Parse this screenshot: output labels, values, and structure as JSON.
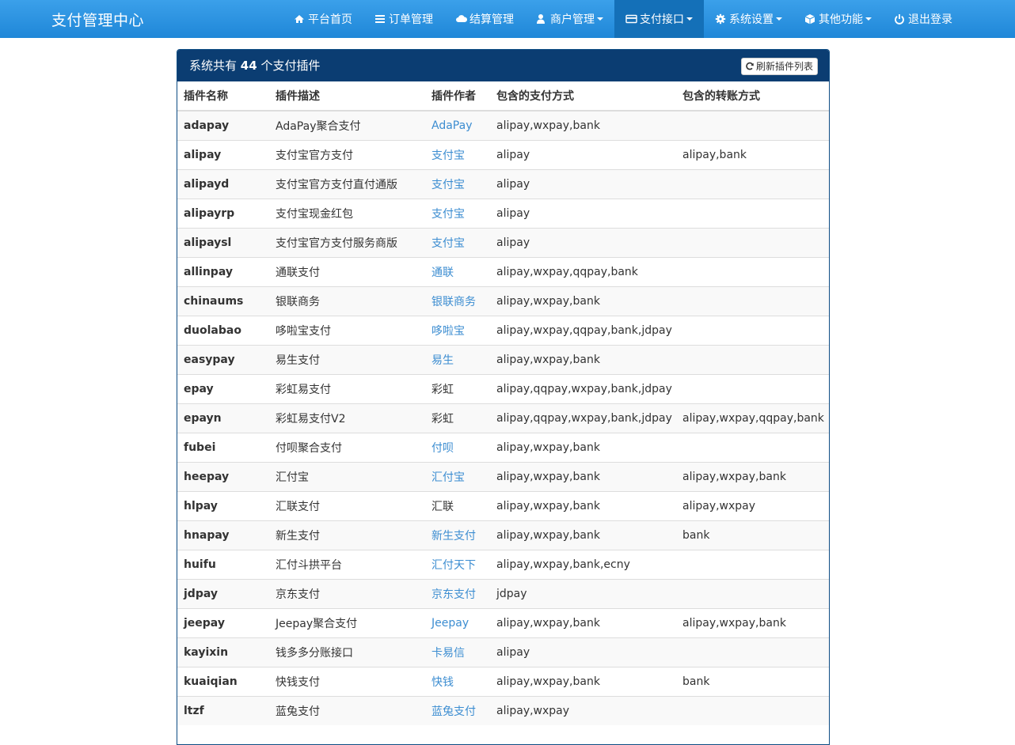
{
  "nav": {
    "brand": "支付管理中心",
    "items": [
      {
        "label": "平台首页",
        "icon": "home-icon",
        "caret": false,
        "active": false
      },
      {
        "label": "订单管理",
        "icon": "list-icon",
        "caret": false,
        "active": false
      },
      {
        "label": "结算管理",
        "icon": "cloud-icon",
        "caret": false,
        "active": false
      },
      {
        "label": "商户管理",
        "icon": "user-icon",
        "caret": true,
        "active": false
      },
      {
        "label": "支付接口",
        "icon": "credit-card-icon",
        "caret": true,
        "active": true
      },
      {
        "label": "系统设置",
        "icon": "gear-icon",
        "caret": true,
        "active": false
      },
      {
        "label": "其他功能",
        "icon": "cube-icon",
        "caret": true,
        "active": false
      },
      {
        "label": "退出登录",
        "icon": "power-icon",
        "caret": false,
        "active": false
      }
    ]
  },
  "panel": {
    "title_prefix": "系统共有",
    "count": "44",
    "title_suffix": "个支付插件",
    "refresh_label": "刷新插件列表"
  },
  "table": {
    "headers": [
      "插件名称",
      "插件描述",
      "插件作者",
      "包含的支付方式",
      "包含的转账方式"
    ],
    "rows": [
      {
        "name": "adapay",
        "desc": "AdaPay聚合支付",
        "author": "AdaPay",
        "author_link": true,
        "pay": "alipay,wxpay,bank",
        "transfer": ""
      },
      {
        "name": "alipay",
        "desc": "支付宝官方支付",
        "author": "支付宝",
        "author_link": true,
        "pay": "alipay",
        "transfer": "alipay,bank"
      },
      {
        "name": "alipayd",
        "desc": "支付宝官方支付直付通版",
        "author": "支付宝",
        "author_link": true,
        "pay": "alipay",
        "transfer": ""
      },
      {
        "name": "alipayrp",
        "desc": "支付宝现金红包",
        "author": "支付宝",
        "author_link": true,
        "pay": "alipay",
        "transfer": ""
      },
      {
        "name": "alipaysl",
        "desc": "支付宝官方支付服务商版",
        "author": "支付宝",
        "author_link": true,
        "pay": "alipay",
        "transfer": ""
      },
      {
        "name": "allinpay",
        "desc": "通联支付",
        "author": "通联",
        "author_link": true,
        "pay": "alipay,wxpay,qqpay,bank",
        "transfer": ""
      },
      {
        "name": "chinaums",
        "desc": "银联商务",
        "author": "银联商务",
        "author_link": true,
        "pay": "alipay,wxpay,bank",
        "transfer": ""
      },
      {
        "name": "duolabao",
        "desc": "哆啦宝支付",
        "author": "哆啦宝",
        "author_link": true,
        "pay": "alipay,wxpay,qqpay,bank,jdpay",
        "transfer": ""
      },
      {
        "name": "easypay",
        "desc": "易生支付",
        "author": "易生",
        "author_link": true,
        "pay": "alipay,wxpay,bank",
        "transfer": ""
      },
      {
        "name": "epay",
        "desc": "彩虹易支付",
        "author": "彩虹",
        "author_link": false,
        "pay": "alipay,qqpay,wxpay,bank,jdpay",
        "transfer": ""
      },
      {
        "name": "epayn",
        "desc": "彩虹易支付V2",
        "author": "彩虹",
        "author_link": false,
        "pay": "alipay,qqpay,wxpay,bank,jdpay",
        "transfer": "alipay,wxpay,qqpay,bank"
      },
      {
        "name": "fubei",
        "desc": "付呗聚合支付",
        "author": "付呗",
        "author_link": true,
        "pay": "alipay,wxpay,bank",
        "transfer": ""
      },
      {
        "name": "heepay",
        "desc": "汇付宝",
        "author": "汇付宝",
        "author_link": true,
        "pay": "alipay,wxpay,bank",
        "transfer": "alipay,wxpay,bank"
      },
      {
        "name": "hlpay",
        "desc": "汇联支付",
        "author": "汇联",
        "author_link": false,
        "pay": "alipay,wxpay,bank",
        "transfer": "alipay,wxpay"
      },
      {
        "name": "hnapay",
        "desc": "新生支付",
        "author": "新生支付",
        "author_link": true,
        "pay": "alipay,wxpay,bank",
        "transfer": "bank"
      },
      {
        "name": "huifu",
        "desc": "汇付斗拱平台",
        "author": "汇付天下",
        "author_link": true,
        "pay": "alipay,wxpay,bank,ecny",
        "transfer": ""
      },
      {
        "name": "jdpay",
        "desc": "京东支付",
        "author": "京东支付",
        "author_link": true,
        "pay": "jdpay",
        "transfer": ""
      },
      {
        "name": "jeepay",
        "desc": "Jeepay聚合支付",
        "author": "Jeepay",
        "author_link": true,
        "pay": "alipay,wxpay,bank",
        "transfer": "alipay,wxpay,bank"
      },
      {
        "name": "kayixin",
        "desc": "钱多多分账接口",
        "author": "卡易信",
        "author_link": true,
        "pay": "alipay",
        "transfer": ""
      },
      {
        "name": "kuaiqian",
        "desc": "快钱支付",
        "author": "快钱",
        "author_link": true,
        "pay": "alipay,wxpay,bank",
        "transfer": "bank"
      },
      {
        "name": "ltzf",
        "desc": "蓝兔支付",
        "author": "蓝兔支付",
        "author_link": true,
        "pay": "alipay,wxpay",
        "transfer": ""
      }
    ]
  },
  "colors": {
    "navbar": "#2a94e2",
    "nav_active": "#1470b8",
    "panel_heading": "#0b3d72",
    "link": "#3c8dd1"
  }
}
